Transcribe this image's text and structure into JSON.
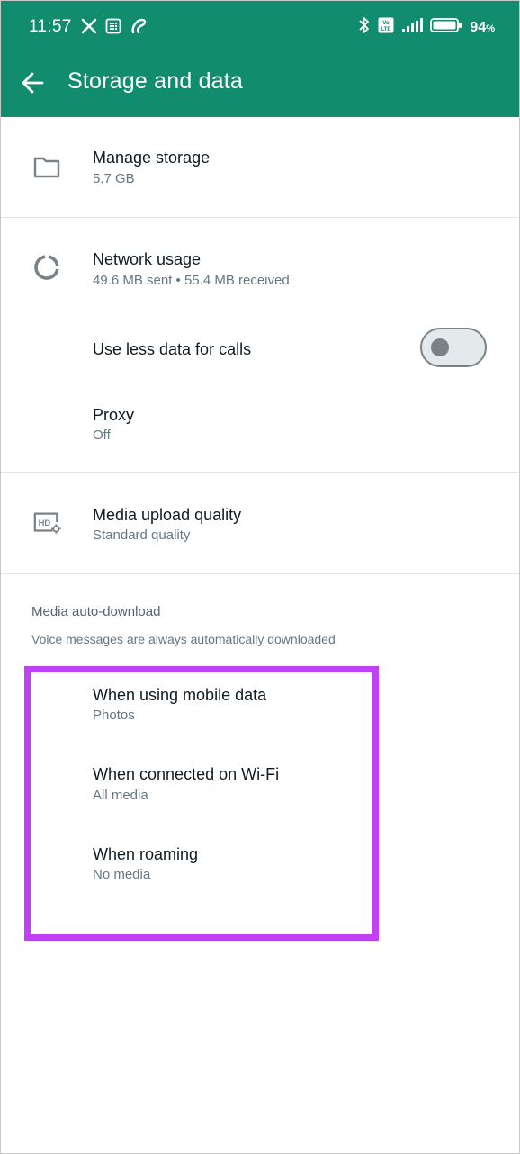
{
  "status_bar": {
    "time": "11:57",
    "battery_percent": "94",
    "battery_symbol": "%",
    "icons": [
      "x-app-icon",
      "sim-toolkit-icon",
      "airtel-icon",
      "bluetooth-icon",
      "volte-icon",
      "signal-icon",
      "battery-icon"
    ]
  },
  "header": {
    "title": "Storage and data",
    "background_color": "#128c6e"
  },
  "items": {
    "manage_storage": {
      "title": "Manage storage",
      "subtitle": "5.7 GB"
    },
    "network_usage": {
      "title": "Network usage",
      "subtitle": "49.6 MB sent • 55.4 MB received"
    },
    "less_data_calls": {
      "title": "Use less data for calls",
      "toggle_on": false
    },
    "proxy": {
      "title": "Proxy",
      "subtitle": "Off"
    },
    "media_upload": {
      "title": "Media upload quality",
      "subtitle": "Standard quality"
    }
  },
  "auto_download": {
    "header": "Media auto-download",
    "note": "Voice messages are always automatically downloaded",
    "mobile_data": {
      "title": "When using mobile data",
      "subtitle": "Photos"
    },
    "wifi": {
      "title": "When connected on Wi-Fi",
      "subtitle": "All media"
    },
    "roaming": {
      "title": "When roaming",
      "subtitle": "No media"
    },
    "highlight_color": "#c040f8"
  }
}
